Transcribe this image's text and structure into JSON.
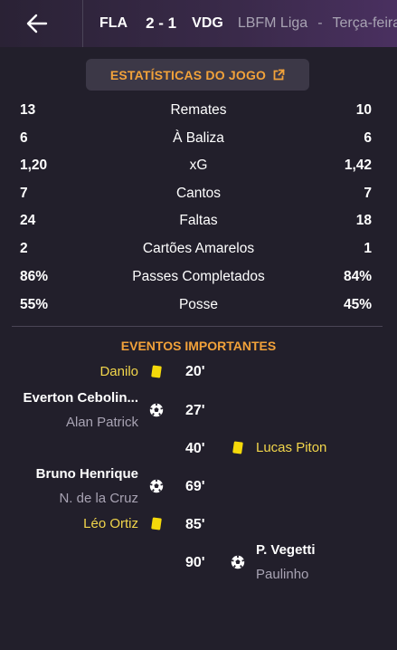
{
  "header": {
    "home_team": "FLA",
    "score": "2 - 1",
    "away_team": "VDG",
    "competition": "LBFM Liga",
    "separator": "-",
    "date": "Terça-feira"
  },
  "stats_button": {
    "label": "ESTATÍSTICAS DO JOGO"
  },
  "stats": [
    {
      "name": "Remates",
      "home": "13",
      "away": "10"
    },
    {
      "name": "À Baliza",
      "home": "6",
      "away": "6"
    },
    {
      "name": "xG",
      "home": "1,20",
      "away": "1,42"
    },
    {
      "name": "Cantos",
      "home": "7",
      "away": "7"
    },
    {
      "name": "Faltas",
      "home": "24",
      "away": "18"
    },
    {
      "name": "Cartões Amarelos",
      "home": "2",
      "away": "1"
    },
    {
      "name": "Passes Completados",
      "home": "86%",
      "away": "84%"
    },
    {
      "name": "Posse",
      "home": "55%",
      "away": "45%"
    }
  ],
  "events_title": "EVENTOS IMPORTANTES",
  "events": [
    {
      "minute": "20'",
      "type": "yellow-card",
      "side": "home",
      "player": "Danilo"
    },
    {
      "minute": "27'",
      "type": "goal",
      "side": "home",
      "player": "Everton Cebolin...",
      "assist": "Alan Patrick"
    },
    {
      "minute": "40'",
      "type": "yellow-card",
      "side": "away",
      "player": "Lucas Piton"
    },
    {
      "minute": "69'",
      "type": "goal",
      "side": "home",
      "player": "Bruno Henrique",
      "assist": "N. de la Cruz"
    },
    {
      "minute": "85'",
      "type": "yellow-card",
      "side": "home",
      "player": "Léo Ortiz"
    },
    {
      "minute": "90'",
      "type": "goal",
      "side": "away",
      "player": "P. Vegetti",
      "assist": "Paulinho"
    }
  ],
  "colors": {
    "background": "#221f2b",
    "accent": "#f2a23a",
    "yellow_card": "#f5d90a",
    "card_player_name": "#f2d64b",
    "muted_text": "#a8a3b3"
  },
  "icons": [
    "back-arrow-icon",
    "external-link-icon",
    "yellow-card-icon",
    "football-icon"
  ]
}
